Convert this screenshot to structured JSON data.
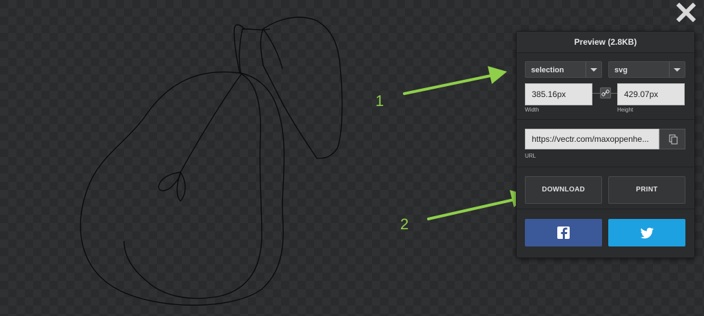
{
  "panel": {
    "title": "Preview (2.8KB)",
    "scope_select": "selection",
    "format_select": "svg",
    "width_value": "385.16px",
    "width_label": "Width",
    "height_value": "429.07px",
    "height_label": "Height",
    "url_value": "https://vectr.com/maxoppenhe...",
    "url_label": "URL",
    "download_label": "DOWNLOAD",
    "print_label": "PRINT",
    "facebook_icon": "facebook-icon",
    "twitter_icon": "twitter-icon"
  },
  "annotations": {
    "step1": "1",
    "step2": "2",
    "arrow_color": "#8fcf4a"
  },
  "colors": {
    "facebook": "#3b5998",
    "twitter": "#1da1e0"
  }
}
